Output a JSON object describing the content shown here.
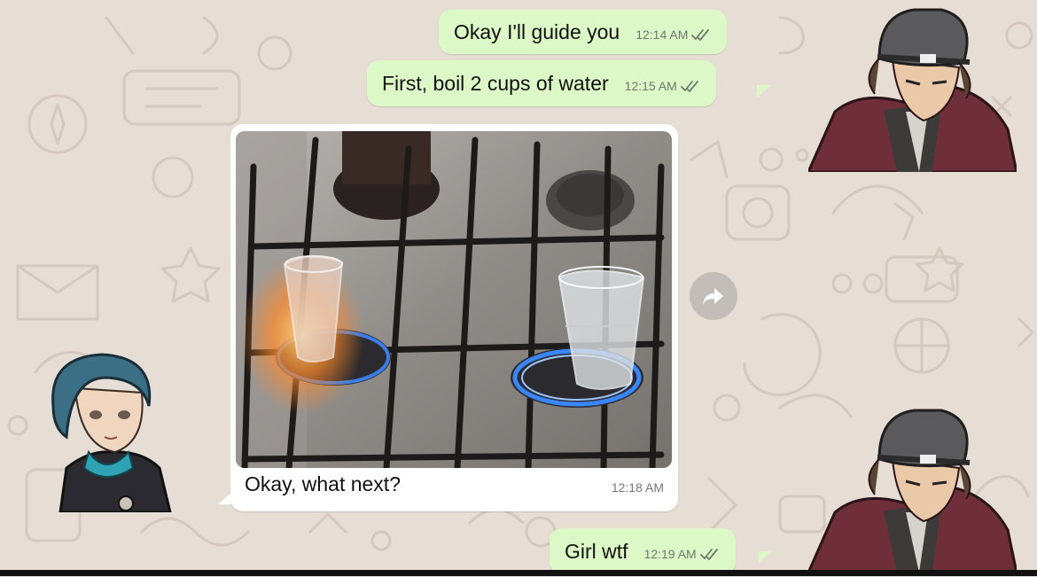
{
  "messages": [
    {
      "id": "m1",
      "direction": "out",
      "text": "Okay I'll guide you",
      "time": "12:14 AM",
      "status": "read"
    },
    {
      "id": "m2",
      "direction": "out",
      "text": "First, boil 2 cups of water",
      "time": "12:15 AM",
      "status": "read"
    },
    {
      "id": "m3",
      "direction": "in",
      "type": "image",
      "caption": "Okay, what next?",
      "time": "12:18 AM"
    },
    {
      "id": "m4",
      "direction": "out",
      "text": "Girl wtf",
      "time": "12:19 AM",
      "status": "read"
    }
  ],
  "colors": {
    "wallpaper": "#e6ddd4",
    "outgoing_bubble": "#dcf8c6",
    "incoming_bubble": "#ffffff",
    "read_ticks": "#6b7b6b",
    "burner_flame": "#3a86ff",
    "fire": "#ff8a2b"
  },
  "icons": {
    "forward": "forward-arrow-icon",
    "read_receipt": "double-check-icon"
  },
  "stickers": [
    {
      "name": "sticker-boy-top",
      "character": "boy-with-gray-beanie-red-coat"
    },
    {
      "name": "sticker-girl",
      "character": "girl-with-teal-bob-hair"
    },
    {
      "name": "sticker-boy-bottom",
      "character": "boy-with-gray-beanie-red-coat"
    }
  ]
}
